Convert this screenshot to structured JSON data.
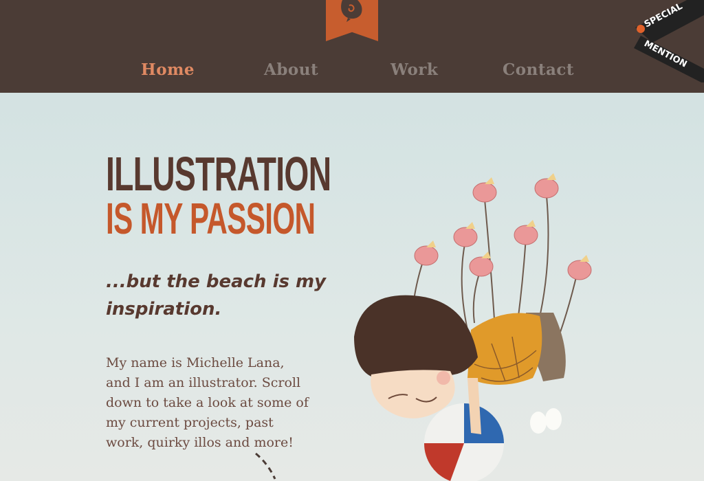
{
  "nav": {
    "items": [
      {
        "label": "Home",
        "active": true
      },
      {
        "label": "About",
        "active": false
      },
      {
        "label": "Work",
        "active": false
      },
      {
        "label": "Contact",
        "active": false
      }
    ]
  },
  "badge": {
    "line1": "SPECIAL",
    "line2": "MENTION"
  },
  "hero": {
    "headline_line1": "ILLUSTRATION",
    "headline_line2": "IS MY PASSION",
    "tagline": "...but the beach is my inspiration.",
    "intro": "My name is Michelle Lana, and I am an illustrator. Scroll down to take a look at some of my current projects, past work, quirky illos and more!"
  },
  "colors": {
    "header_bg": "#4b3c36",
    "accent": "#c75d2e",
    "nav_active": "#e08a63",
    "nav_inactive": "#8a807b",
    "headline_dark": "#58392f",
    "headline_orange": "#c5582b",
    "page_bg": "#d5e4e4"
  }
}
